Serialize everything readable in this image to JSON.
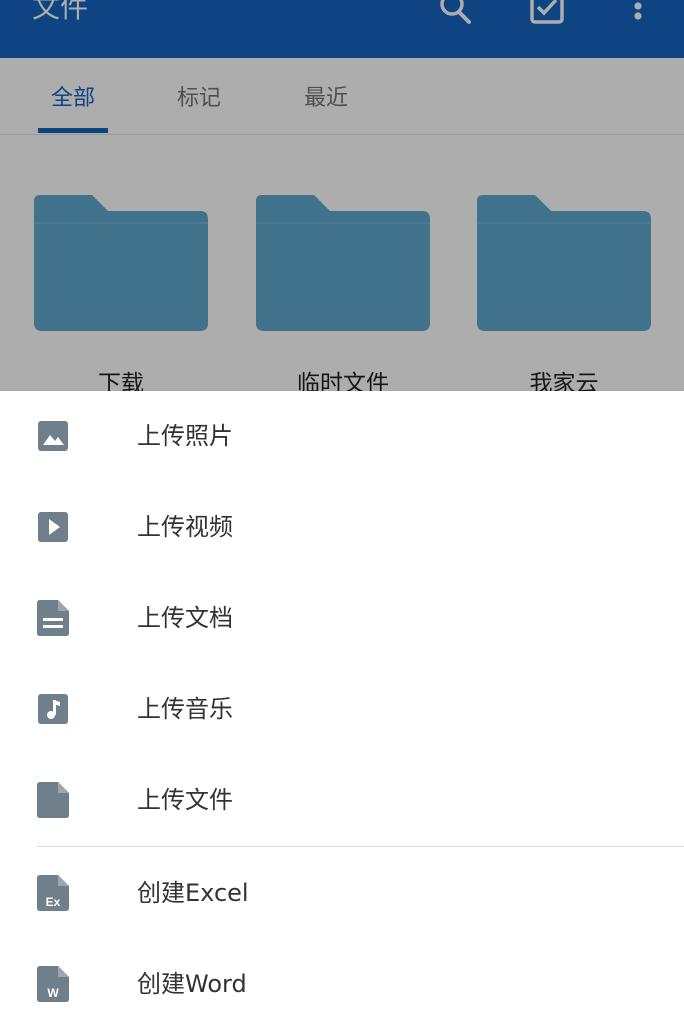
{
  "appbar": {
    "title": "文件",
    "icons": [
      "search-icon",
      "select-all-icon",
      "more-vert-icon"
    ]
  },
  "tabs": [
    {
      "label": "全部",
      "active": true
    },
    {
      "label": "标记",
      "active": false
    },
    {
      "label": "最近",
      "active": false
    }
  ],
  "folders": [
    {
      "name": "下载"
    },
    {
      "name": "临时文件"
    },
    {
      "name": "我家云"
    }
  ],
  "sheet": {
    "items": [
      {
        "label": "上传照片",
        "icon": "image-icon"
      },
      {
        "label": "上传视频",
        "icon": "video-icon"
      },
      {
        "label": "上传文档",
        "icon": "document-icon"
      },
      {
        "label": "上传音乐",
        "icon": "music-icon"
      },
      {
        "label": "上传文件",
        "icon": "file-icon"
      },
      {
        "label": "创建Excel",
        "icon": "excel-icon",
        "badge": "Ex"
      },
      {
        "label": "创建Word",
        "icon": "word-icon",
        "badge": "W"
      }
    ]
  },
  "colors": {
    "primary": "#1565c0",
    "folder": "#5fa8cf",
    "icon_gray": "#6f7f8c"
  }
}
